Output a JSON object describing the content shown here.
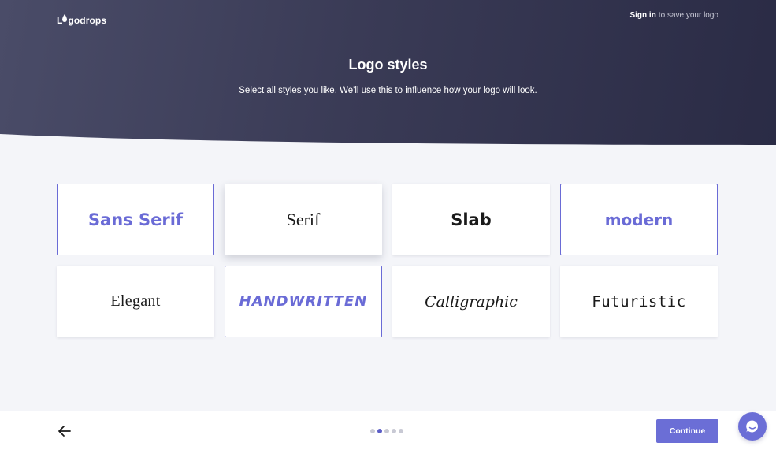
{
  "header": {
    "brand": "Logodrops",
    "brand_rest": "godrops",
    "signin_link": "Sign in",
    "signin_suffix": "to save your logo"
  },
  "hero": {
    "title": "Logo styles",
    "subtitle": "Select all styles you like. We'll use this to influence how your logo will look."
  },
  "styles": [
    {
      "label": "Sans Serif",
      "selected": true
    },
    {
      "label": "Serif",
      "selected": false
    },
    {
      "label": "Slab",
      "selected": false
    },
    {
      "label": "modern",
      "selected": true
    },
    {
      "label": "Elegant",
      "selected": false
    },
    {
      "label": "Handwritten",
      "selected": true
    },
    {
      "label": "Calligraphic",
      "selected": false
    },
    {
      "label": "Futuristic",
      "selected": false
    }
  ],
  "footer": {
    "back_icon": "arrow-left-icon",
    "steps_total": 5,
    "step_active": 2,
    "continue_label": "Continue",
    "chat_icon": "chat-bubble-icon"
  },
  "colors": {
    "accent": "#6b6ed6",
    "hero_dark": "#2a2b45",
    "background": "#f4f5f9"
  }
}
